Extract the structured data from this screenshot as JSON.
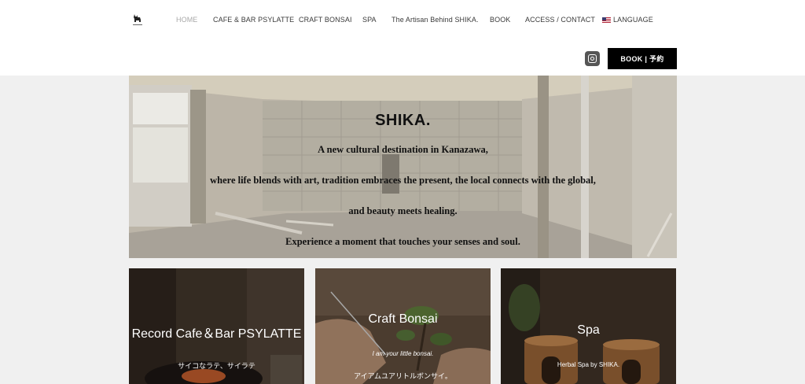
{
  "header": {
    "nav": [
      {
        "label": "HOME",
        "active": true
      },
      {
        "label": "CAFE & BAR PSYLATTE",
        "active": false
      },
      {
        "label": "CRAFT BONSAI",
        "active": false
      },
      {
        "label": "SPA",
        "active": false
      },
      {
        "label": "The Artisan Behind SHIKA.",
        "active": false
      },
      {
        "label": "BOOK",
        "active": false
      },
      {
        "label": "ACCESS / CONTACT",
        "active": false
      },
      {
        "label": "LANGUAGE",
        "active": false
      }
    ],
    "book_button": "BOOK | 予約",
    "logo_icon": "deer-logo-icon",
    "social_icon": "instagram-icon"
  },
  "hero": {
    "title": "SHIKA.",
    "lines": [
      "A new cultural destination in Kanazawa,",
      "where life blends with art, tradition embraces the present, the local connects with the global,",
      "and beauty meets healing.",
      "Experience a moment that touches your senses and soul."
    ]
  },
  "cards": [
    {
      "title": "Record Cafe＆Bar PSYLATTE",
      "subtitle": "サイコなラテ、サイラテ"
    },
    {
      "title": "Craft Bonsai",
      "subtitle": "I am your little bonsai.",
      "subtitle2": "アイアムユアリトルボンサイ。"
    },
    {
      "title": "Spa",
      "subtitle": "Herbal Spa by SHIKA."
    }
  ],
  "colors": {
    "book_button_bg": "#000000",
    "nav_active": "#a8a8a8",
    "page_bg": "#f0f0f0"
  }
}
